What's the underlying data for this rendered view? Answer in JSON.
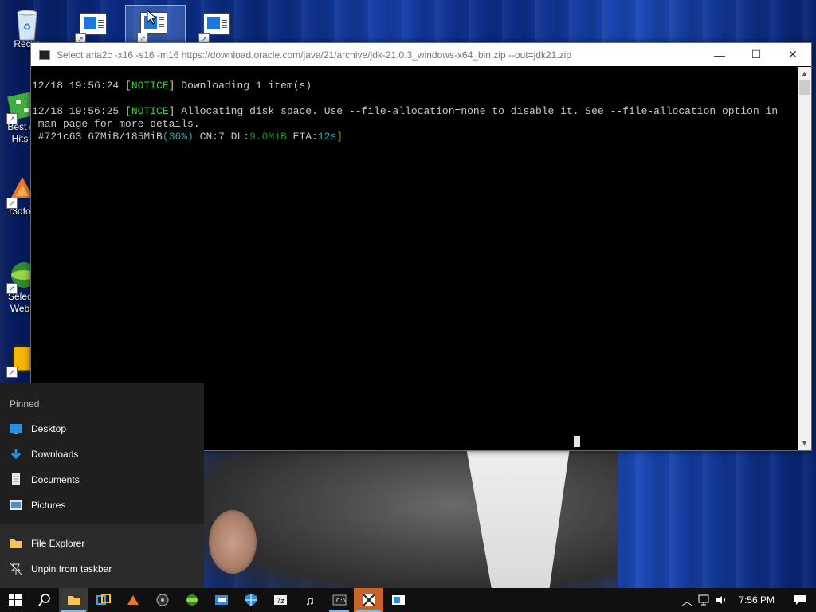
{
  "desktop": {
    "icons": [
      {
        "label": "Recyc",
        "name": "recycle-bin"
      },
      {
        "label": "Best (",
        "label2": "Hits",
        "name": "best-hits"
      },
      {
        "label": "r3dfo",
        "name": "r3dfox"
      },
      {
        "label": "Selec",
        "label2": "Web",
        "name": "select-web"
      }
    ]
  },
  "console": {
    "title": "Select aria2c  -x16 -s16 -m16 https://download.oracle.com/java/21/archive/jdk-21.0.3_windows-x64_bin.zip --out=jdk21.zip",
    "line1_time": "12/18 19:56:24 ",
    "line1_tag": "NOTICE",
    "line1_msg": " Downloading 1 item(s)",
    "line2_time": "12/18 19:56:25 ",
    "line2_tag": "NOTICE",
    "line2_msg": " Allocating disk space. Use --file-allocation=none to disable it. See --file-allocation option in",
    "line3": " man page for more details.",
    "progress_id": " #721c63 67MiB/185MiB",
    "progress_pct": "(36%)",
    "progress_cn": " CN:7 DL:",
    "progress_dl": "9.0MiB",
    "progress_eta_label": " ETA:",
    "progress_eta": "12s",
    "progress_end": "]",
    "minimize": "—",
    "maximize": "☐",
    "close": "✕"
  },
  "jumplist": {
    "heading": "Pinned",
    "pinned": [
      "Desktop",
      "Downloads",
      "Documents",
      "Pictures"
    ],
    "app": "File Explorer",
    "unpin": "Unpin from taskbar"
  },
  "taskbar": {
    "time": "7:56 PM"
  },
  "colors": {
    "notice_green": "#2fd42f",
    "percent_teal": "#2aa8a8",
    "accent": "#76b9ed"
  }
}
